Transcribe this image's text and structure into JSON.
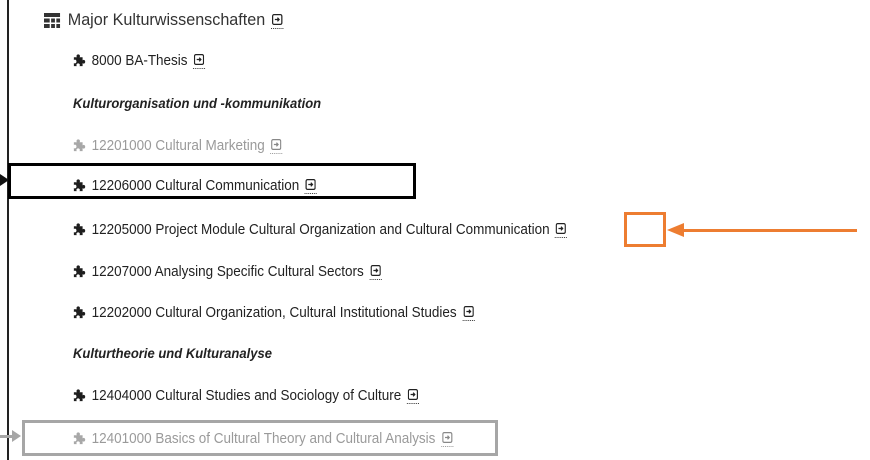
{
  "title": {
    "label": "Major Kulturwissenschaften",
    "icon": "grid-icon"
  },
  "items": [
    {
      "kind": "module",
      "label": "8000 BA-Thesis",
      "disabled": false,
      "icon": "puzzle-icon"
    },
    {
      "kind": "section",
      "label": "Kulturorganisation und -kommunikation"
    },
    {
      "kind": "module",
      "label": "12201000 Cultural Marketing",
      "disabled": true,
      "icon": "puzzle-icon"
    },
    {
      "kind": "module",
      "label": "12206000 Cultural Communication",
      "disabled": false,
      "icon": "puzzle-icon"
    },
    {
      "kind": "module",
      "label": "12205000 Project Module Cultural Organization and Cultural Communication",
      "disabled": false,
      "icon": "puzzle-icon"
    },
    {
      "kind": "module",
      "label": "12207000 Analysing Specific Cultural Sectors",
      "disabled": false,
      "icon": "puzzle-icon"
    },
    {
      "kind": "module",
      "label": "12202000 Cultural Organization, Cultural Institutional Studies",
      "disabled": false,
      "icon": "puzzle-icon"
    },
    {
      "kind": "section",
      "label": "Kulturtheorie und Kulturanalyse"
    },
    {
      "kind": "module",
      "label": "12404000 Cultural Studies and Sociology of Culture",
      "disabled": false,
      "icon": "puzzle-icon"
    },
    {
      "kind": "module",
      "label": "12401000 Basics of Cultural Theory and Cultural Analysis",
      "disabled": true,
      "icon": "puzzle-icon"
    }
  ],
  "annotations": {
    "highlight_black": "#000000",
    "highlight_gray": "#a6a6a6",
    "highlight_orange": "#ed7d31"
  }
}
